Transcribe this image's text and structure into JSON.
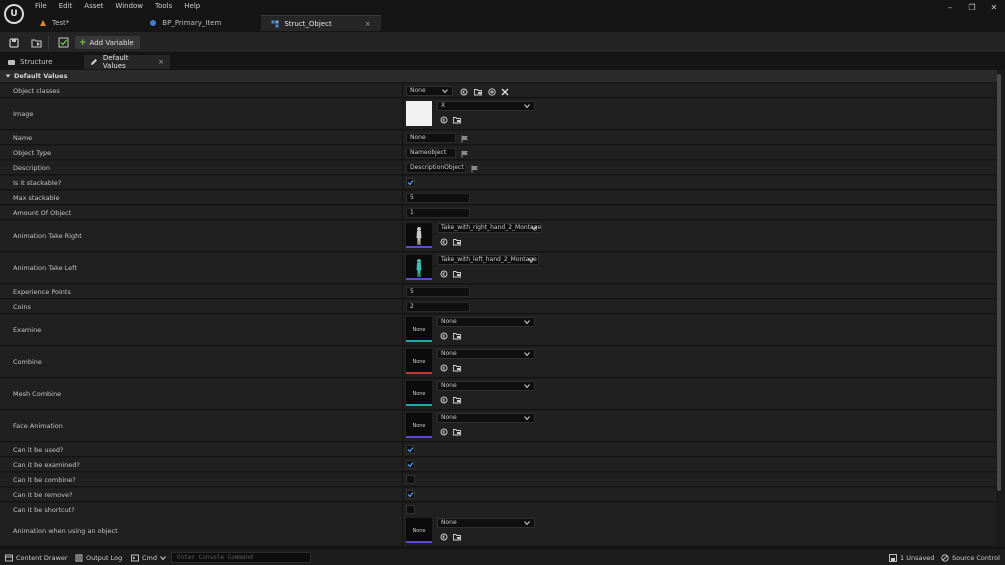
{
  "menu": [
    "File",
    "Edit",
    "Asset",
    "Window",
    "Tools",
    "Help"
  ],
  "doc_tabs": [
    {
      "label": "Test*"
    },
    {
      "label": "BP_Primary_Item"
    },
    {
      "label": "Struct_Object",
      "close": "×"
    }
  ],
  "toolbar": {
    "add_variable": "Add Variable",
    "plus": "+"
  },
  "panel_tabs": {
    "structure": "Structure",
    "default_values": "Default Values",
    "close": "×"
  },
  "section": {
    "title": "Default Values"
  },
  "rows": {
    "object_classes": {
      "label": "Object classes",
      "value": "None"
    },
    "image": {
      "label": "Image",
      "value": "X"
    },
    "name": {
      "label": "Name",
      "value": "None"
    },
    "object_type": {
      "label": "Object Type",
      "value": "Nameobject"
    },
    "description": {
      "label": "Description",
      "value": "DescriptionObject"
    },
    "is_stackable": {
      "label": "Is it stackable?",
      "checked": true
    },
    "max_stackable": {
      "label": "Max stackable",
      "value": "5"
    },
    "amount": {
      "label": "Amount Of Object",
      "value": "1"
    },
    "anim_take_right": {
      "label": "Animation Take Right",
      "value": "Take_with_right_hand_2_Montage"
    },
    "anim_take_left": {
      "label": "Animation Take Left",
      "value": "Take_with_left_hand_2_Montage"
    },
    "experience": {
      "label": "Experience Points",
      "value": "5"
    },
    "coins": {
      "label": "Coins",
      "value": "2"
    },
    "examine": {
      "label": "Examine",
      "value": "None",
      "thumb": "None",
      "accent": "#1fa5b5"
    },
    "combine": {
      "label": "Combine",
      "value": "None",
      "thumb": "None",
      "accent": "#c0393b"
    },
    "mesh_combine": {
      "label": "Mesh Combine",
      "value": "None",
      "thumb": "None",
      "accent": "#1fa5b5"
    },
    "face_animation": {
      "label": "Face Animation",
      "value": "None",
      "thumb": "None",
      "accent": "#5b4ad6"
    },
    "can_used": {
      "label": "Can it be used?",
      "checked": true
    },
    "can_examined": {
      "label": "Can it be examined?",
      "checked": true
    },
    "can_combine": {
      "label": "Can it be combine?",
      "checked": false
    },
    "can_remove": {
      "label": "Can it be remove?",
      "checked": true
    },
    "can_shortcut": {
      "label": "Can it be shortcut?",
      "checked": false
    },
    "anim_using": {
      "label": "Animation when using an object",
      "value": "None",
      "thumb": "None",
      "accent": "#5b4ad6"
    }
  },
  "status": {
    "content_drawer": "Content Drawer",
    "output_log": "Output Log",
    "cmd": "Cmd",
    "console_placeholder": "Enter Console Command",
    "unsaved": "1 Unsaved",
    "source_control": "Source Control"
  },
  "colors": {
    "check": "#4c9bf2",
    "add": "#6fce3b",
    "montage_accent": "#5b4ad6"
  }
}
